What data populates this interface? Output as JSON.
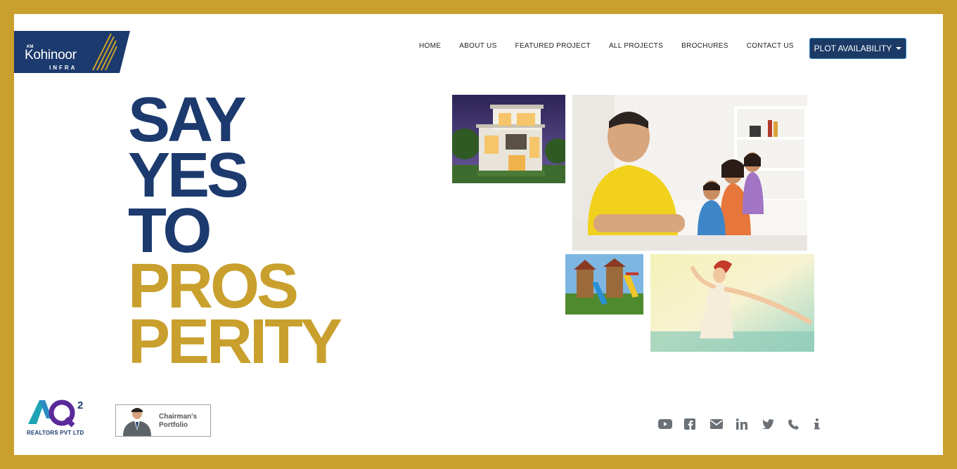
{
  "brand": {
    "km": "KM",
    "name": "Kohinoor",
    "infra": "INFRA",
    "navy": "#1c3a6e",
    "gold": "#c9a02d"
  },
  "nav": {
    "items": [
      "HOME",
      "ABOUT US",
      "FEATURED PROJECT",
      "ALL PROJECTS",
      "BROCHURES",
      "CONTACT US"
    ],
    "cta_label": "PLOT AVAILABILITY"
  },
  "headline": {
    "line1": "SAY",
    "line2": "YES",
    "line3": "TO",
    "line4": "PROS",
    "line5": "PERITY"
  },
  "footer": {
    "partner_logo_text": "AQ",
    "partner_superscript": "2",
    "partner_name": "REALTORS PVT LTD",
    "chairman_label_1": "Chairman's",
    "chairman_label_2": "Portfolio",
    "social_icons": [
      "youtube-icon",
      "facebook-icon",
      "email-icon",
      "linkedin-icon",
      "twitter-icon",
      "phone-icon",
      "info-icon"
    ]
  }
}
